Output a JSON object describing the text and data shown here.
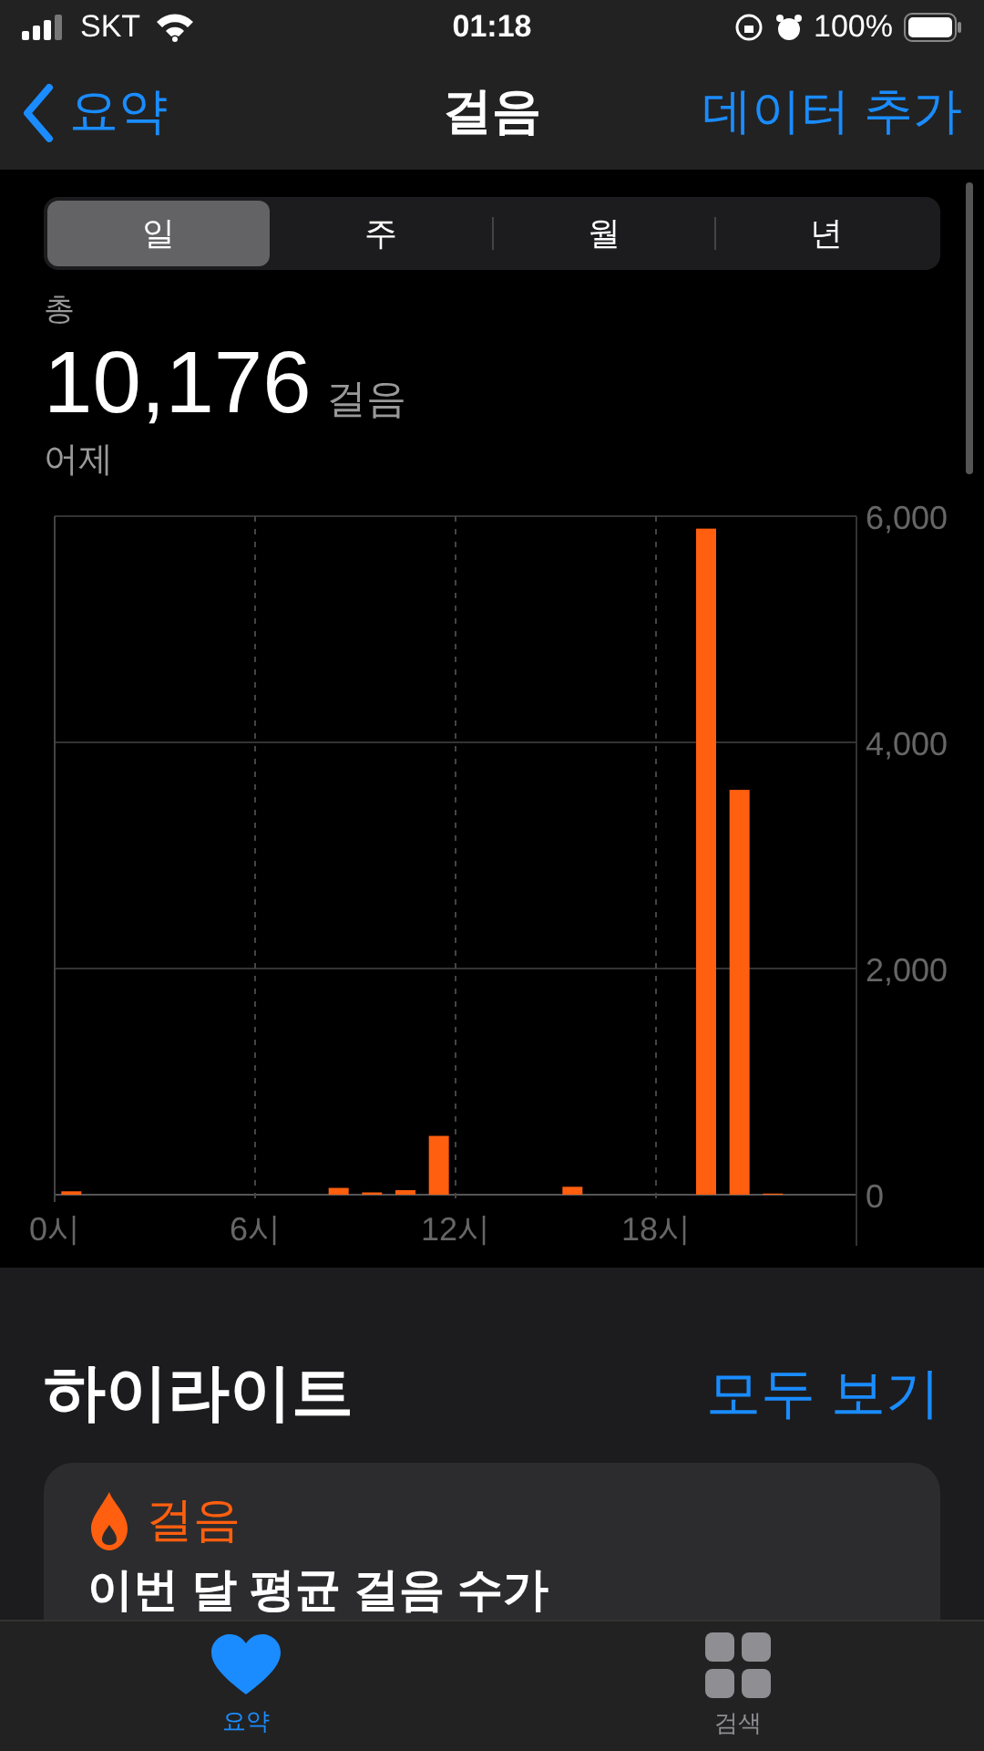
{
  "status_bar": {
    "carrier": "SKT",
    "time": "01:18",
    "battery": "100%"
  },
  "nav": {
    "back": "요약",
    "title": "걸음",
    "action": "데이터 추가"
  },
  "segments": [
    {
      "label": "일",
      "selected": true
    },
    {
      "label": "주",
      "selected": false
    },
    {
      "label": "월",
      "selected": false
    },
    {
      "label": "년",
      "selected": false
    }
  ],
  "summary": {
    "label": "총",
    "value": "10,176",
    "unit": "걸음",
    "date": "어제"
  },
  "chart_data": {
    "type": "bar",
    "x": [
      0.5,
      1.5,
      2.5,
      3.5,
      4.5,
      5.5,
      6.5,
      7.5,
      8.5,
      9.5,
      10.5,
      11.5,
      12.5,
      13.5,
      14.5,
      15.5,
      16.5,
      17.5,
      18.5,
      19.5,
      20.5,
      21.5,
      22.5,
      23.5
    ],
    "xlim": [
      0,
      24
    ],
    "grid": true,
    "series": [
      {
        "color": "#ff5f0f",
        "values": [
          30,
          0,
          0,
          0,
          0,
          0,
          0,
          0,
          60,
          20,
          40,
          520,
          0,
          0,
          0,
          70,
          0,
          0,
          0,
          5890,
          3580,
          10,
          0,
          0
        ]
      }
    ],
    "xticks": [
      {
        "value": 0,
        "label": "0시"
      },
      {
        "value": 6,
        "label": "6시"
      },
      {
        "value": 12,
        "label": "12시"
      },
      {
        "value": 18,
        "label": "18시"
      }
    ],
    "ylim": [
      0,
      6000
    ],
    "yticks": [
      {
        "value": 0,
        "label": "0"
      },
      {
        "value": 2000,
        "label": "2,000"
      },
      {
        "value": 4000,
        "label": "4,000"
      },
      {
        "value": 6000,
        "label": "6,000"
      }
    ]
  },
  "highlights": {
    "title": "하이라이트",
    "see_all": "모두 보기",
    "card": {
      "category": "걸음",
      "text": "이번 달 평균 걸음 수가"
    }
  },
  "tab_bar": [
    {
      "label": "요약",
      "selected": true,
      "kind": "heart"
    },
    {
      "label": "검색",
      "selected": false,
      "kind": "grid"
    }
  ]
}
